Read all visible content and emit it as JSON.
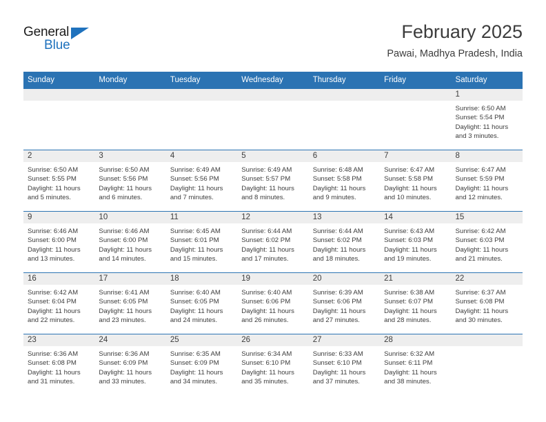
{
  "brand": {
    "name_part1": "General",
    "name_part2": "Blue",
    "triangle_icon": "triangle-icon",
    "accent_color": "#1f72bd"
  },
  "header": {
    "title": "February 2025",
    "subtitle": "Pawai, Madhya Pradesh, India"
  },
  "colors": {
    "header_blue": "#2b73b3",
    "day_band_gray": "#eeeeee",
    "text": "#3c3c3c"
  },
  "weekdays": [
    "Sunday",
    "Monday",
    "Tuesday",
    "Wednesday",
    "Thursday",
    "Friday",
    "Saturday"
  ],
  "weeks": [
    [
      {
        "day": "",
        "sunrise": "",
        "sunset": "",
        "daylight_line1": "",
        "daylight_line2": "",
        "empty": true
      },
      {
        "day": "",
        "sunrise": "",
        "sunset": "",
        "daylight_line1": "",
        "daylight_line2": "",
        "empty": true
      },
      {
        "day": "",
        "sunrise": "",
        "sunset": "",
        "daylight_line1": "",
        "daylight_line2": "",
        "empty": true
      },
      {
        "day": "",
        "sunrise": "",
        "sunset": "",
        "daylight_line1": "",
        "daylight_line2": "",
        "empty": true
      },
      {
        "day": "",
        "sunrise": "",
        "sunset": "",
        "daylight_line1": "",
        "daylight_line2": "",
        "empty": true
      },
      {
        "day": "",
        "sunrise": "",
        "sunset": "",
        "daylight_line1": "",
        "daylight_line2": "",
        "empty": true
      },
      {
        "day": "1",
        "sunrise": "Sunrise: 6:50 AM",
        "sunset": "Sunset: 5:54 PM",
        "daylight_line1": "Daylight: 11 hours",
        "daylight_line2": "and 3 minutes."
      }
    ],
    [
      {
        "day": "2",
        "sunrise": "Sunrise: 6:50 AM",
        "sunset": "Sunset: 5:55 PM",
        "daylight_line1": "Daylight: 11 hours",
        "daylight_line2": "and 5 minutes."
      },
      {
        "day": "3",
        "sunrise": "Sunrise: 6:50 AM",
        "sunset": "Sunset: 5:56 PM",
        "daylight_line1": "Daylight: 11 hours",
        "daylight_line2": "and 6 minutes."
      },
      {
        "day": "4",
        "sunrise": "Sunrise: 6:49 AM",
        "sunset": "Sunset: 5:56 PM",
        "daylight_line1": "Daylight: 11 hours",
        "daylight_line2": "and 7 minutes."
      },
      {
        "day": "5",
        "sunrise": "Sunrise: 6:49 AM",
        "sunset": "Sunset: 5:57 PM",
        "daylight_line1": "Daylight: 11 hours",
        "daylight_line2": "and 8 minutes."
      },
      {
        "day": "6",
        "sunrise": "Sunrise: 6:48 AM",
        "sunset": "Sunset: 5:58 PM",
        "daylight_line1": "Daylight: 11 hours",
        "daylight_line2": "and 9 minutes."
      },
      {
        "day": "7",
        "sunrise": "Sunrise: 6:47 AM",
        "sunset": "Sunset: 5:58 PM",
        "daylight_line1": "Daylight: 11 hours",
        "daylight_line2": "and 10 minutes."
      },
      {
        "day": "8",
        "sunrise": "Sunrise: 6:47 AM",
        "sunset": "Sunset: 5:59 PM",
        "daylight_line1": "Daylight: 11 hours",
        "daylight_line2": "and 12 minutes."
      }
    ],
    [
      {
        "day": "9",
        "sunrise": "Sunrise: 6:46 AM",
        "sunset": "Sunset: 6:00 PM",
        "daylight_line1": "Daylight: 11 hours",
        "daylight_line2": "and 13 minutes."
      },
      {
        "day": "10",
        "sunrise": "Sunrise: 6:46 AM",
        "sunset": "Sunset: 6:00 PM",
        "daylight_line1": "Daylight: 11 hours",
        "daylight_line2": "and 14 minutes."
      },
      {
        "day": "11",
        "sunrise": "Sunrise: 6:45 AM",
        "sunset": "Sunset: 6:01 PM",
        "daylight_line1": "Daylight: 11 hours",
        "daylight_line2": "and 15 minutes."
      },
      {
        "day": "12",
        "sunrise": "Sunrise: 6:44 AM",
        "sunset": "Sunset: 6:02 PM",
        "daylight_line1": "Daylight: 11 hours",
        "daylight_line2": "and 17 minutes."
      },
      {
        "day": "13",
        "sunrise": "Sunrise: 6:44 AM",
        "sunset": "Sunset: 6:02 PM",
        "daylight_line1": "Daylight: 11 hours",
        "daylight_line2": "and 18 minutes."
      },
      {
        "day": "14",
        "sunrise": "Sunrise: 6:43 AM",
        "sunset": "Sunset: 6:03 PM",
        "daylight_line1": "Daylight: 11 hours",
        "daylight_line2": "and 19 minutes."
      },
      {
        "day": "15",
        "sunrise": "Sunrise: 6:42 AM",
        "sunset": "Sunset: 6:03 PM",
        "daylight_line1": "Daylight: 11 hours",
        "daylight_line2": "and 21 minutes."
      }
    ],
    [
      {
        "day": "16",
        "sunrise": "Sunrise: 6:42 AM",
        "sunset": "Sunset: 6:04 PM",
        "daylight_line1": "Daylight: 11 hours",
        "daylight_line2": "and 22 minutes."
      },
      {
        "day": "17",
        "sunrise": "Sunrise: 6:41 AM",
        "sunset": "Sunset: 6:05 PM",
        "daylight_line1": "Daylight: 11 hours",
        "daylight_line2": "and 23 minutes."
      },
      {
        "day": "18",
        "sunrise": "Sunrise: 6:40 AM",
        "sunset": "Sunset: 6:05 PM",
        "daylight_line1": "Daylight: 11 hours",
        "daylight_line2": "and 24 minutes."
      },
      {
        "day": "19",
        "sunrise": "Sunrise: 6:40 AM",
        "sunset": "Sunset: 6:06 PM",
        "daylight_line1": "Daylight: 11 hours",
        "daylight_line2": "and 26 minutes."
      },
      {
        "day": "20",
        "sunrise": "Sunrise: 6:39 AM",
        "sunset": "Sunset: 6:06 PM",
        "daylight_line1": "Daylight: 11 hours",
        "daylight_line2": "and 27 minutes."
      },
      {
        "day": "21",
        "sunrise": "Sunrise: 6:38 AM",
        "sunset": "Sunset: 6:07 PM",
        "daylight_line1": "Daylight: 11 hours",
        "daylight_line2": "and 28 minutes."
      },
      {
        "day": "22",
        "sunrise": "Sunrise: 6:37 AM",
        "sunset": "Sunset: 6:08 PM",
        "daylight_line1": "Daylight: 11 hours",
        "daylight_line2": "and 30 minutes."
      }
    ],
    [
      {
        "day": "23",
        "sunrise": "Sunrise: 6:36 AM",
        "sunset": "Sunset: 6:08 PM",
        "daylight_line1": "Daylight: 11 hours",
        "daylight_line2": "and 31 minutes."
      },
      {
        "day": "24",
        "sunrise": "Sunrise: 6:36 AM",
        "sunset": "Sunset: 6:09 PM",
        "daylight_line1": "Daylight: 11 hours",
        "daylight_line2": "and 33 minutes."
      },
      {
        "day": "25",
        "sunrise": "Sunrise: 6:35 AM",
        "sunset": "Sunset: 6:09 PM",
        "daylight_line1": "Daylight: 11 hours",
        "daylight_line2": "and 34 minutes."
      },
      {
        "day": "26",
        "sunrise": "Sunrise: 6:34 AM",
        "sunset": "Sunset: 6:10 PM",
        "daylight_line1": "Daylight: 11 hours",
        "daylight_line2": "and 35 minutes."
      },
      {
        "day": "27",
        "sunrise": "Sunrise: 6:33 AM",
        "sunset": "Sunset: 6:10 PM",
        "daylight_line1": "Daylight: 11 hours",
        "daylight_line2": "and 37 minutes."
      },
      {
        "day": "28",
        "sunrise": "Sunrise: 6:32 AM",
        "sunset": "Sunset: 6:11 PM",
        "daylight_line1": "Daylight: 11 hours",
        "daylight_line2": "and 38 minutes."
      },
      {
        "day": "",
        "sunrise": "",
        "sunset": "",
        "daylight_line1": "",
        "daylight_line2": "",
        "empty": true
      }
    ]
  ]
}
